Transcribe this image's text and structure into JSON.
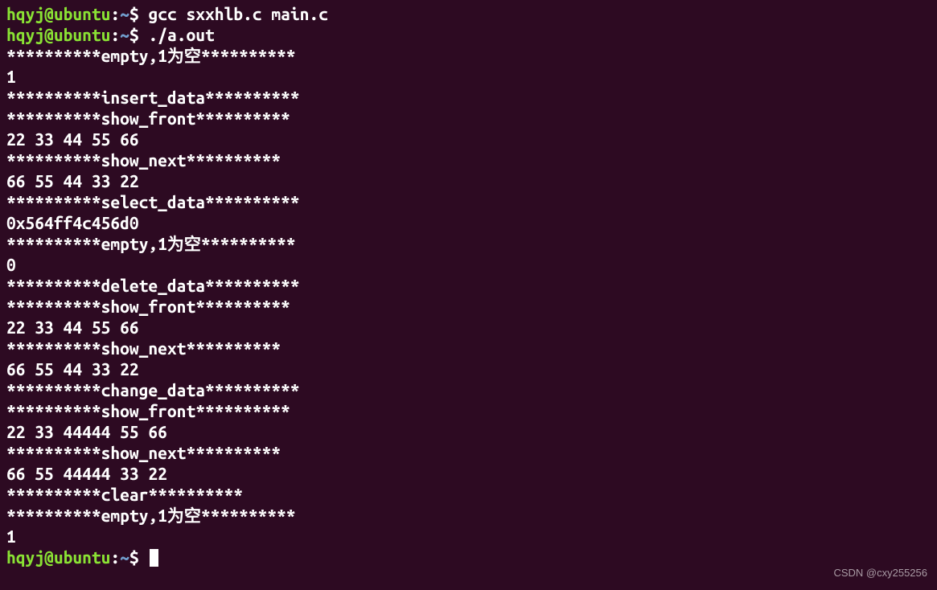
{
  "prompt": {
    "user": "hqyj",
    "at": "@",
    "host": "ubuntu",
    "colon": ":",
    "path": "~",
    "dollar": "$"
  },
  "lines": [
    {
      "type": "prompt",
      "command": "gcc sxxhlb.c main.c"
    },
    {
      "type": "prompt",
      "command": "./a.out"
    },
    {
      "type": "output",
      "text": "**********empty,1为空**********"
    },
    {
      "type": "output",
      "text": "1"
    },
    {
      "type": "output",
      "text": "**********insert_data**********"
    },
    {
      "type": "output",
      "text": "**********show_front**********"
    },
    {
      "type": "output",
      "text": "22 33 44 55 66 "
    },
    {
      "type": "output",
      "text": "**********show_next**********"
    },
    {
      "type": "output",
      "text": "66 55 44 33 22 "
    },
    {
      "type": "output",
      "text": "**********select_data**********"
    },
    {
      "type": "output",
      "text": "0x564ff4c456d0"
    },
    {
      "type": "output",
      "text": "**********empty,1为空**********"
    },
    {
      "type": "output",
      "text": "0"
    },
    {
      "type": "output",
      "text": "**********delete_data**********"
    },
    {
      "type": "output",
      "text": "**********show_front**********"
    },
    {
      "type": "output",
      "text": "22 33 44 55 66 "
    },
    {
      "type": "output",
      "text": "**********show_next**********"
    },
    {
      "type": "output",
      "text": "66 55 44 33 22 "
    },
    {
      "type": "output",
      "text": "**********change_data**********"
    },
    {
      "type": "output",
      "text": "**********show_front**********"
    },
    {
      "type": "output",
      "text": "22 33 44444 55 66 "
    },
    {
      "type": "output",
      "text": "**********show_next**********"
    },
    {
      "type": "output",
      "text": "66 55 44444 33 22 "
    },
    {
      "type": "output",
      "text": "**********clear**********"
    },
    {
      "type": "output",
      "text": "**********empty,1为空**********"
    },
    {
      "type": "output",
      "text": "1"
    },
    {
      "type": "prompt",
      "command": "",
      "cursor": true
    }
  ],
  "watermark": "CSDN @cxy255256"
}
